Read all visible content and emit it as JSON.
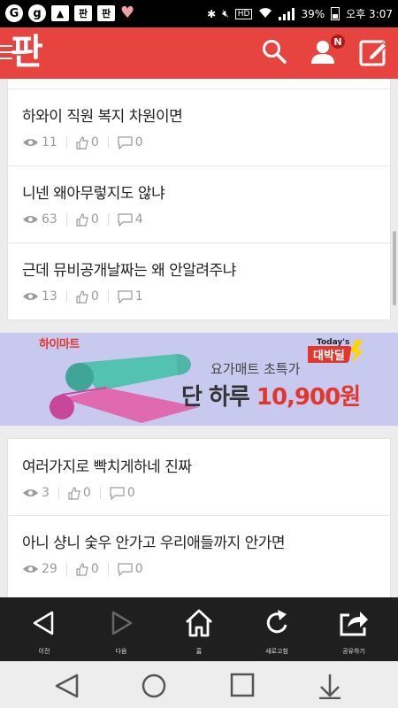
{
  "status_bar": {
    "icons_left": [
      "g-app-icon",
      "g-circle-icon",
      "image-icon",
      "pan-app-icon",
      "pan-app-icon",
      "heart-icon"
    ],
    "app_icon_text": "판",
    "hd": "HD",
    "battery": "39%",
    "time": "오후 3:07"
  },
  "header": {
    "logo": "판",
    "notification_badge": "N"
  },
  "posts_top": [
    {
      "title": "하와이 직원 복지 차원이면",
      "views": "11",
      "likes": "0",
      "comments": "0"
    },
    {
      "title": "니넨 왜아무렇지도 않냐",
      "views": "63",
      "likes": "0",
      "comments": "4"
    },
    {
      "title": "근데 뮤비공개날짜는 왜 안알려주냐",
      "views": "13",
      "likes": "0",
      "comments": "1"
    }
  ],
  "ad": {
    "brand": "하이마트",
    "badge_top": "Today's",
    "badge_main": "대박딜",
    "subtitle": "요가매트 초특가",
    "headline_prefix": "단 하루 ",
    "headline_price": "10,900원",
    "colors": {
      "background": "#c8c9ee",
      "accent": "#e3362d"
    }
  },
  "posts_bottom": [
    {
      "title": "여러가지로 빡치게하네 진짜",
      "views": "3",
      "likes": "0",
      "comments": "0"
    },
    {
      "title": "아니 샹니 숯우 안가고 우리애들까지 안가면",
      "views": "29",
      "likes": "0",
      "comments": "0"
    }
  ],
  "toolbar": {
    "back": "이전",
    "forward": "다음",
    "home": "홈",
    "refresh": "새로고침",
    "share": "공유하기"
  },
  "colors": {
    "brand": "#e8443f",
    "toolbar": "#1f1f1f"
  }
}
